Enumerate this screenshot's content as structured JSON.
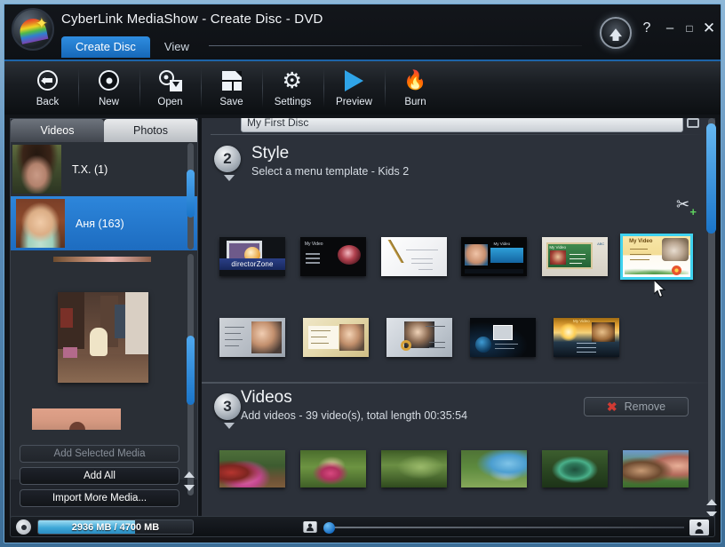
{
  "window": {
    "title": "CyberLink MediaShow - Create Disc - DVD",
    "logo_icon": "rainbow-star-logo",
    "up_button_icon": "up-arrow-icon",
    "help_label": "?",
    "minimize_label": "–",
    "maximize_label": "□",
    "close_label": "✕"
  },
  "menu_tabs": [
    {
      "label": "Create Disc",
      "active": true
    },
    {
      "label": "View",
      "active": false
    }
  ],
  "toolbar": [
    {
      "label": "Back",
      "icon": "back-arrow-icon"
    },
    {
      "label": "New",
      "icon": "disc-icon"
    },
    {
      "label": "Open",
      "icon": "open-folder-icon"
    },
    {
      "label": "Save",
      "icon": "floppy-disk-icon"
    },
    {
      "label": "Settings",
      "icon": "gear-icon"
    },
    {
      "label": "Preview",
      "icon": "play-triangle-icon"
    },
    {
      "label": "Burn",
      "icon": "flame-icon"
    }
  ],
  "sidebar": {
    "tabs": [
      {
        "label": "Videos",
        "active": true
      },
      {
        "label": "Photos",
        "active": false
      }
    ],
    "items": [
      {
        "label": "T.X. (1)",
        "selected": false,
        "thumb": "woman-portrait"
      },
      {
        "label": "Аня (163)",
        "selected": true,
        "thumb": "baby-portrait"
      }
    ],
    "buttons": [
      {
        "label": "Add Selected Media",
        "enabled": false
      },
      {
        "label": "Add All",
        "enabled": true
      },
      {
        "label": "Import More Media...",
        "enabled": true
      }
    ]
  },
  "disc_name": {
    "value": "My First Disc",
    "keyboard_icon": "keyboard-icon"
  },
  "style_section": {
    "number": "2",
    "title": "Style",
    "subtitle": "Select a menu template - Kids 2",
    "collapse_icon": "caret-down-icon",
    "directorzone_icon": "add-template-icon",
    "templates_row1": [
      {
        "name": "directorZone",
        "label": "directorZone",
        "selected": false,
        "style": "t-dzone"
      },
      {
        "name": "dark-elegance",
        "label": "",
        "selected": false,
        "style": "t-black"
      },
      {
        "name": "white-calligraphy",
        "label": "",
        "selected": false,
        "style": "t-white"
      },
      {
        "name": "blue-wave",
        "label": "",
        "selected": false,
        "style": "t-blue"
      },
      {
        "name": "school-board",
        "label": "",
        "selected": false,
        "style": "t-green"
      },
      {
        "name": "kids-2",
        "label": "My Video",
        "selected": true,
        "style": "t-kids"
      }
    ],
    "templates_row2": [
      {
        "name": "grey-couple",
        "label": "",
        "selected": false,
        "style": "t-grey"
      },
      {
        "name": "cream-family",
        "label": "",
        "selected": false,
        "style": "t-cream"
      },
      {
        "name": "wedding-rings",
        "label": "",
        "selected": false,
        "style": "t-wed"
      },
      {
        "name": "dark-globe",
        "label": "",
        "selected": false,
        "style": "t-dark"
      },
      {
        "name": "golden-sunset",
        "label": "",
        "selected": false,
        "style": "t-gold"
      }
    ]
  },
  "videos_section": {
    "number": "3",
    "title": "Videos",
    "subtitle": "Add videos - 39 video(s), total length 00:35:54",
    "collapse_icon": "caret-down-icon",
    "remove_button": {
      "label": "Remove",
      "icon": "red-x-icon"
    },
    "thumbnails": [
      {
        "name": "video-thumb-1",
        "style": "v1"
      },
      {
        "name": "video-thumb-2",
        "style": "v2"
      },
      {
        "name": "video-thumb-3",
        "style": "v3"
      },
      {
        "name": "video-thumb-4",
        "style": "v4"
      },
      {
        "name": "video-thumb-5",
        "style": "v5"
      },
      {
        "name": "video-thumb-6",
        "style": "v6"
      }
    ]
  },
  "status_bar": {
    "disc_icon": "disc-icon",
    "capacity_text": "2936 MB / 4700 MB",
    "capacity_used_mb": 2936,
    "capacity_total_mb": 4700,
    "small_thumb_icon": "small-thumbnail-icon",
    "large_thumb_icon": "large-thumbnail-icon",
    "zoom_slider_value": 0
  },
  "cursor": {
    "icon": "mouse-pointer-icon"
  },
  "colors": {
    "accent_blue": "#1d6cc0",
    "selection_cyan": "#3fd2ef",
    "capacity_fill": "#3fa8d8",
    "panel_bg": "#2c313a"
  }
}
